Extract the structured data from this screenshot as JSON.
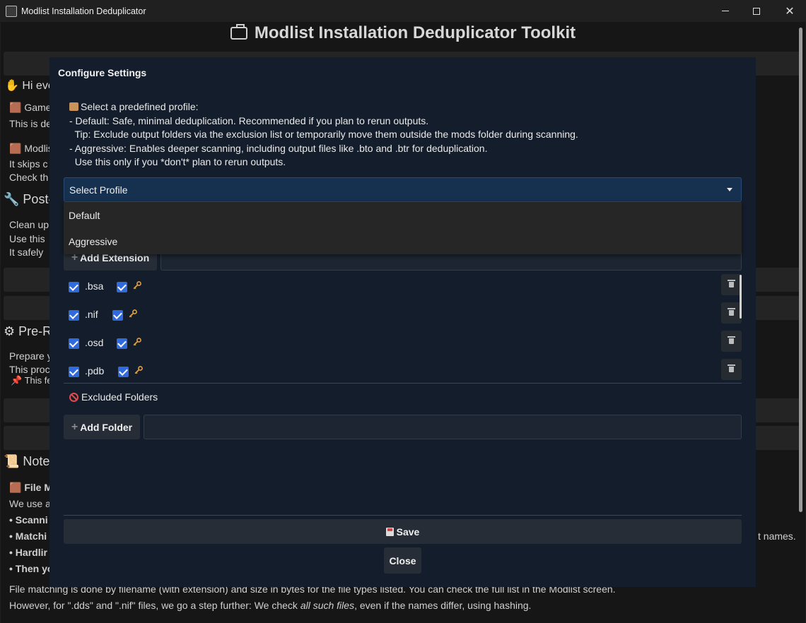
{
  "window": {
    "title": "Modlist Installation Deduplicator"
  },
  "background": {
    "app_title": "Modlist Installation Deduplicator Toolkit",
    "lines": [
      {
        "key": "hi",
        "text": "Hi eve"
      },
      {
        "key": "game",
        "text": "Game"
      },
      {
        "key": "this_de",
        "text": "This is de"
      },
      {
        "key": "modlis",
        "text": "Modlis"
      },
      {
        "key": "skips",
        "text": "It skips c"
      },
      {
        "key": "check",
        "text": "Check th"
      },
      {
        "key": "post",
        "text": "Post-"
      },
      {
        "key": "clean",
        "text": "Clean up"
      },
      {
        "key": "usethis",
        "text": "Use this"
      },
      {
        "key": "safely",
        "text": "It safely"
      },
      {
        "key": "pre",
        "text": "Pre-R"
      },
      {
        "key": "prepare",
        "text": "Prepare y"
      },
      {
        "key": "proc",
        "text": "This proc"
      },
      {
        "key": "feat",
        "text": "This fe"
      },
      {
        "key": "notes",
        "text": "Notes"
      },
      {
        "key": "filem",
        "text": "File M"
      },
      {
        "key": "weuse",
        "text": "We use a"
      },
      {
        "key": "scan",
        "text": "• Scanni"
      },
      {
        "key": "match",
        "text": "• Matchi"
      },
      {
        "key": "hard",
        "text": "• Hardlir"
      },
      {
        "key": "then",
        "text": "• Then yo"
      },
      {
        "key": "names",
        "text": "t names."
      },
      {
        "key": "fm1",
        "text": "File matching is done by filename (with extension) and size in bytes for the file types listed. You can check the full list in the Modlist screen."
      },
      {
        "key": "fm2a",
        "text": "However, for \".dds\" and \".nif\" files, we go a step further: We check "
      },
      {
        "key": "fm2b",
        "text": "all such files"
      },
      {
        "key": "fm2c",
        "text": ", even if the names differ, using hashing."
      }
    ]
  },
  "dialog": {
    "title": "Configure Settings",
    "description": [
      "Select a predefined profile:",
      "- Default: Safe, minimal deduplication. Recommended if you plan to rerun outputs.",
      "  Tip: Exclude output folders via the exclusion list or temporarily move them outside the mods folder during scanning.",
      "- Aggressive: Enables deeper scanning, including output files like .bto and .btr for deduplication.",
      "  Use this only if you *don't* plan to rerun outputs."
    ],
    "profile_select": {
      "selected": "Select Profile",
      "options": [
        "Default",
        "Aggressive"
      ]
    },
    "add_extension_label": "Add Extension",
    "extensions": [
      {
        "name": ".bsa",
        "enabled": true,
        "key": true
      },
      {
        "name": ".nif",
        "enabled": true,
        "key": true
      },
      {
        "name": ".osd",
        "enabled": true,
        "key": true
      },
      {
        "name": ".pdb",
        "enabled": true,
        "key": true
      }
    ],
    "excluded_folders_label": "Excluded Folders",
    "add_folder_label": "Add Folder",
    "save_label": "Save",
    "close_label": "Close"
  },
  "colors": {
    "dialog_bg": "#141d2b",
    "accent": "#2f6bdd",
    "select_bg": "#16304f"
  }
}
